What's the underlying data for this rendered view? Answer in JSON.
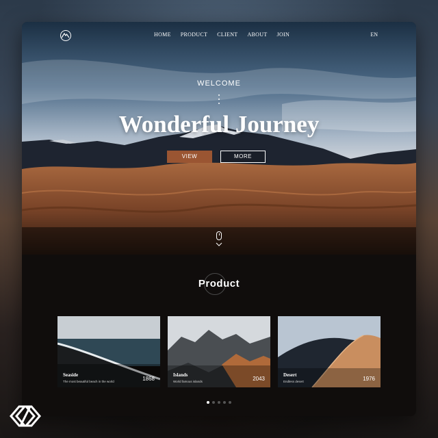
{
  "nav": {
    "items": [
      {
        "label": "HOME"
      },
      {
        "label": "PRODUCT"
      },
      {
        "label": "CLIENT"
      },
      {
        "label": "ABOUT"
      },
      {
        "label": "JOIN"
      }
    ],
    "language": "EN",
    "logo_icon": "mountain-logo-icon"
  },
  "hero": {
    "welcome": "WELCOME",
    "headline": "Wonderful Journey",
    "view_label": "VIEW",
    "more_label": "MORE",
    "scroll_icon": "mouse-scroll-icon",
    "accent_color": "#9a5532"
  },
  "products": {
    "title": "Product",
    "items": [
      {
        "name": "Seaside",
        "desc": "The most beautiful beach in the world",
        "count": "1868"
      },
      {
        "name": "Islands",
        "desc": "World famous islands",
        "count": "2043"
      },
      {
        "name": "Desert",
        "desc": "Endless desert",
        "count": "1976"
      }
    ],
    "pager_count": 5,
    "active_page": 1
  }
}
